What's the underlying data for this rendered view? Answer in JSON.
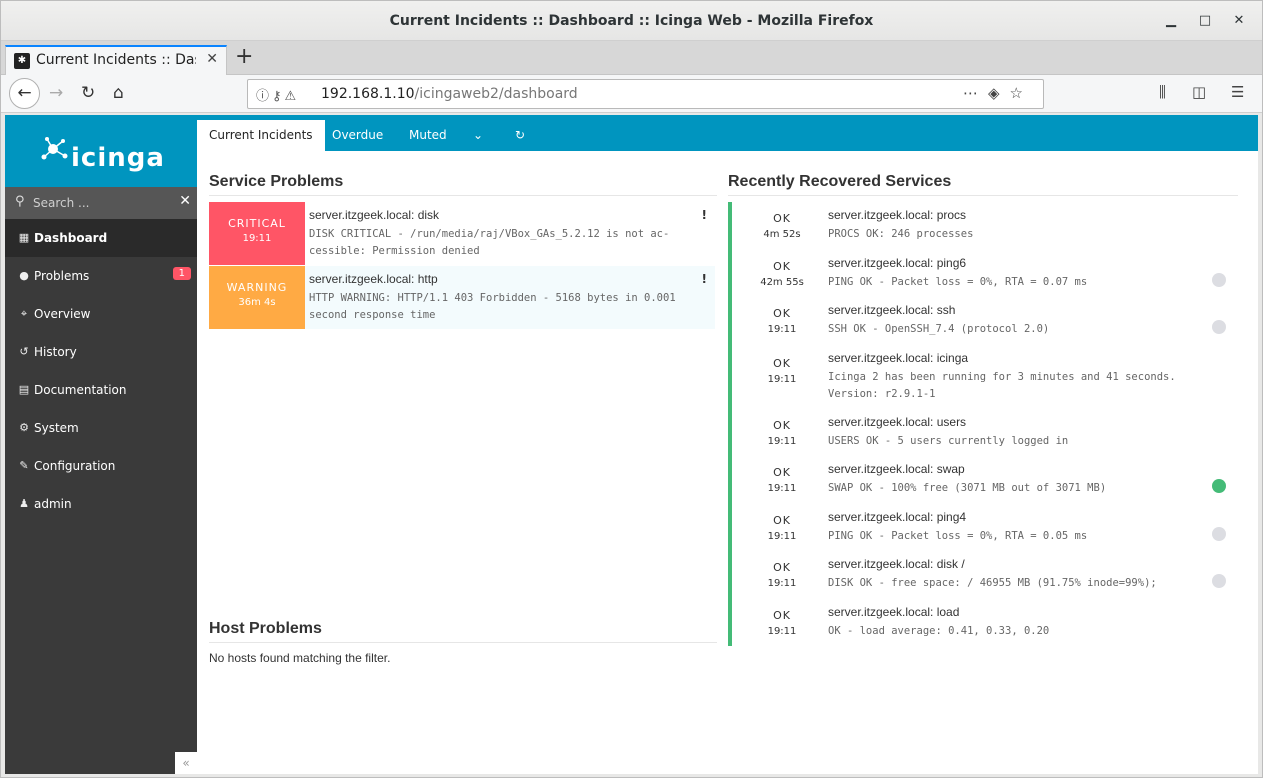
{
  "window": {
    "title": "Current Incidents :: Dashboard :: Icinga Web - Mozilla Firefox",
    "controls": {
      "minimize": "▁",
      "maximize": "□",
      "close": "✕"
    }
  },
  "browser": {
    "tab_title": "Current Incidents :: Dashboard :: Icinga Web",
    "new_tab": "+",
    "url_host": "192.168.1.10",
    "url_path": "/icingaweb2/dashboard",
    "icons": [
      "back-icon",
      "forward-icon",
      "reload-icon",
      "home-icon",
      "info-icon",
      "key-icon",
      "insecure-icon",
      "more-icon",
      "pocket-icon",
      "bookmark-star-icon",
      "library-icon",
      "sidebar-icon",
      "menu-icon"
    ]
  },
  "sidebar": {
    "logo_text": "icinga",
    "search_placeholder": "Search ...",
    "items": [
      {
        "label": "Dashboard",
        "icon": "grid-icon",
        "active": true
      },
      {
        "label": "Problems",
        "icon": "alert-icon",
        "badge": "1"
      },
      {
        "label": "Overview",
        "icon": "binoculars-icon"
      },
      {
        "label": "History",
        "icon": "history-icon"
      },
      {
        "label": "Documentation",
        "icon": "book-icon"
      },
      {
        "label": "System",
        "icon": "cogs-icon"
      },
      {
        "label": "Configuration",
        "icon": "wrench-icon"
      },
      {
        "label": "admin",
        "icon": "user-icon"
      }
    ],
    "collapse": "«"
  },
  "dashboard": {
    "tabs": [
      {
        "label": "Current Incidents",
        "active": true
      },
      {
        "label": "Overdue"
      },
      {
        "label": "Muted"
      },
      {
        "label": "⌄"
      },
      {
        "label": "↻"
      }
    ]
  },
  "service_problems": {
    "heading": "Service Problems",
    "rows": [
      {
        "state": "CRITICAL",
        "time": "19:11",
        "host": "server.itzgeek.local: disk",
        "output": "DISK CRITICAL - /run/media/raj/VBox_GAs_5.2.12 is not ac-cessible: Permission denied",
        "flag": "!"
      },
      {
        "state": "WARNING",
        "time": "36m 4s",
        "host": "server.itzgeek.local: http",
        "output": "HTTP WARNING: HTTP/1.1 403 Forbidden - 5168 bytes in 0.001 second response time",
        "flag": "!"
      }
    ]
  },
  "recovered": {
    "heading": "Recently Recovered Services",
    "rows": [
      {
        "state": "OK",
        "time": "4m 52s",
        "host": "server.itzgeek.local: procs",
        "output": "PROCS OK: 246 processes"
      },
      {
        "state": "OK",
        "time": "42m 55s",
        "host": "server.itzgeek.local: ping6",
        "output": "PING OK - Packet loss = 0%, RTA = 0.07 ms"
      },
      {
        "state": "OK",
        "time": "19:11",
        "host": "server.itzgeek.local: ssh",
        "output": "SSH OK - OpenSSH_7.4 (protocol 2.0)"
      },
      {
        "state": "OK",
        "time": "19:11",
        "host": "server.itzgeek.local: icinga",
        "output": "Icinga 2 has been running for 3 minutes and 41 seconds. Version: r2.9.1-1"
      },
      {
        "state": "OK",
        "time": "19:11",
        "host": "server.itzgeek.local: users",
        "output": "USERS OK - 5 users currently logged in"
      },
      {
        "state": "OK",
        "time": "19:11",
        "host": "server.itzgeek.local: swap",
        "output": "SWAP OK - 100% free (3071 MB out of 3071 MB)"
      },
      {
        "state": "OK",
        "time": "19:11",
        "host": "server.itzgeek.local: ping4",
        "output": "PING OK - Packet loss = 0%, RTA = 0.05 ms"
      },
      {
        "state": "OK",
        "time": "19:11",
        "host": "server.itzgeek.local: disk /",
        "output": "DISK OK - free space: / 46955 MB (91.75% inode=99%);"
      },
      {
        "state": "OK",
        "time": "19:11",
        "host": "server.itzgeek.local: load",
        "output": "OK - load average: 0.41, 0.33, 0.20"
      }
    ]
  },
  "host_problems": {
    "heading": "Host Problems",
    "empty_text": "No hosts found matching the filter."
  },
  "colors": {
    "brand": "#0095bf",
    "critical": "#ff5566",
    "warning": "#ffaa44",
    "ok": "#44bb77",
    "sidebar": "#3a3a3a"
  }
}
